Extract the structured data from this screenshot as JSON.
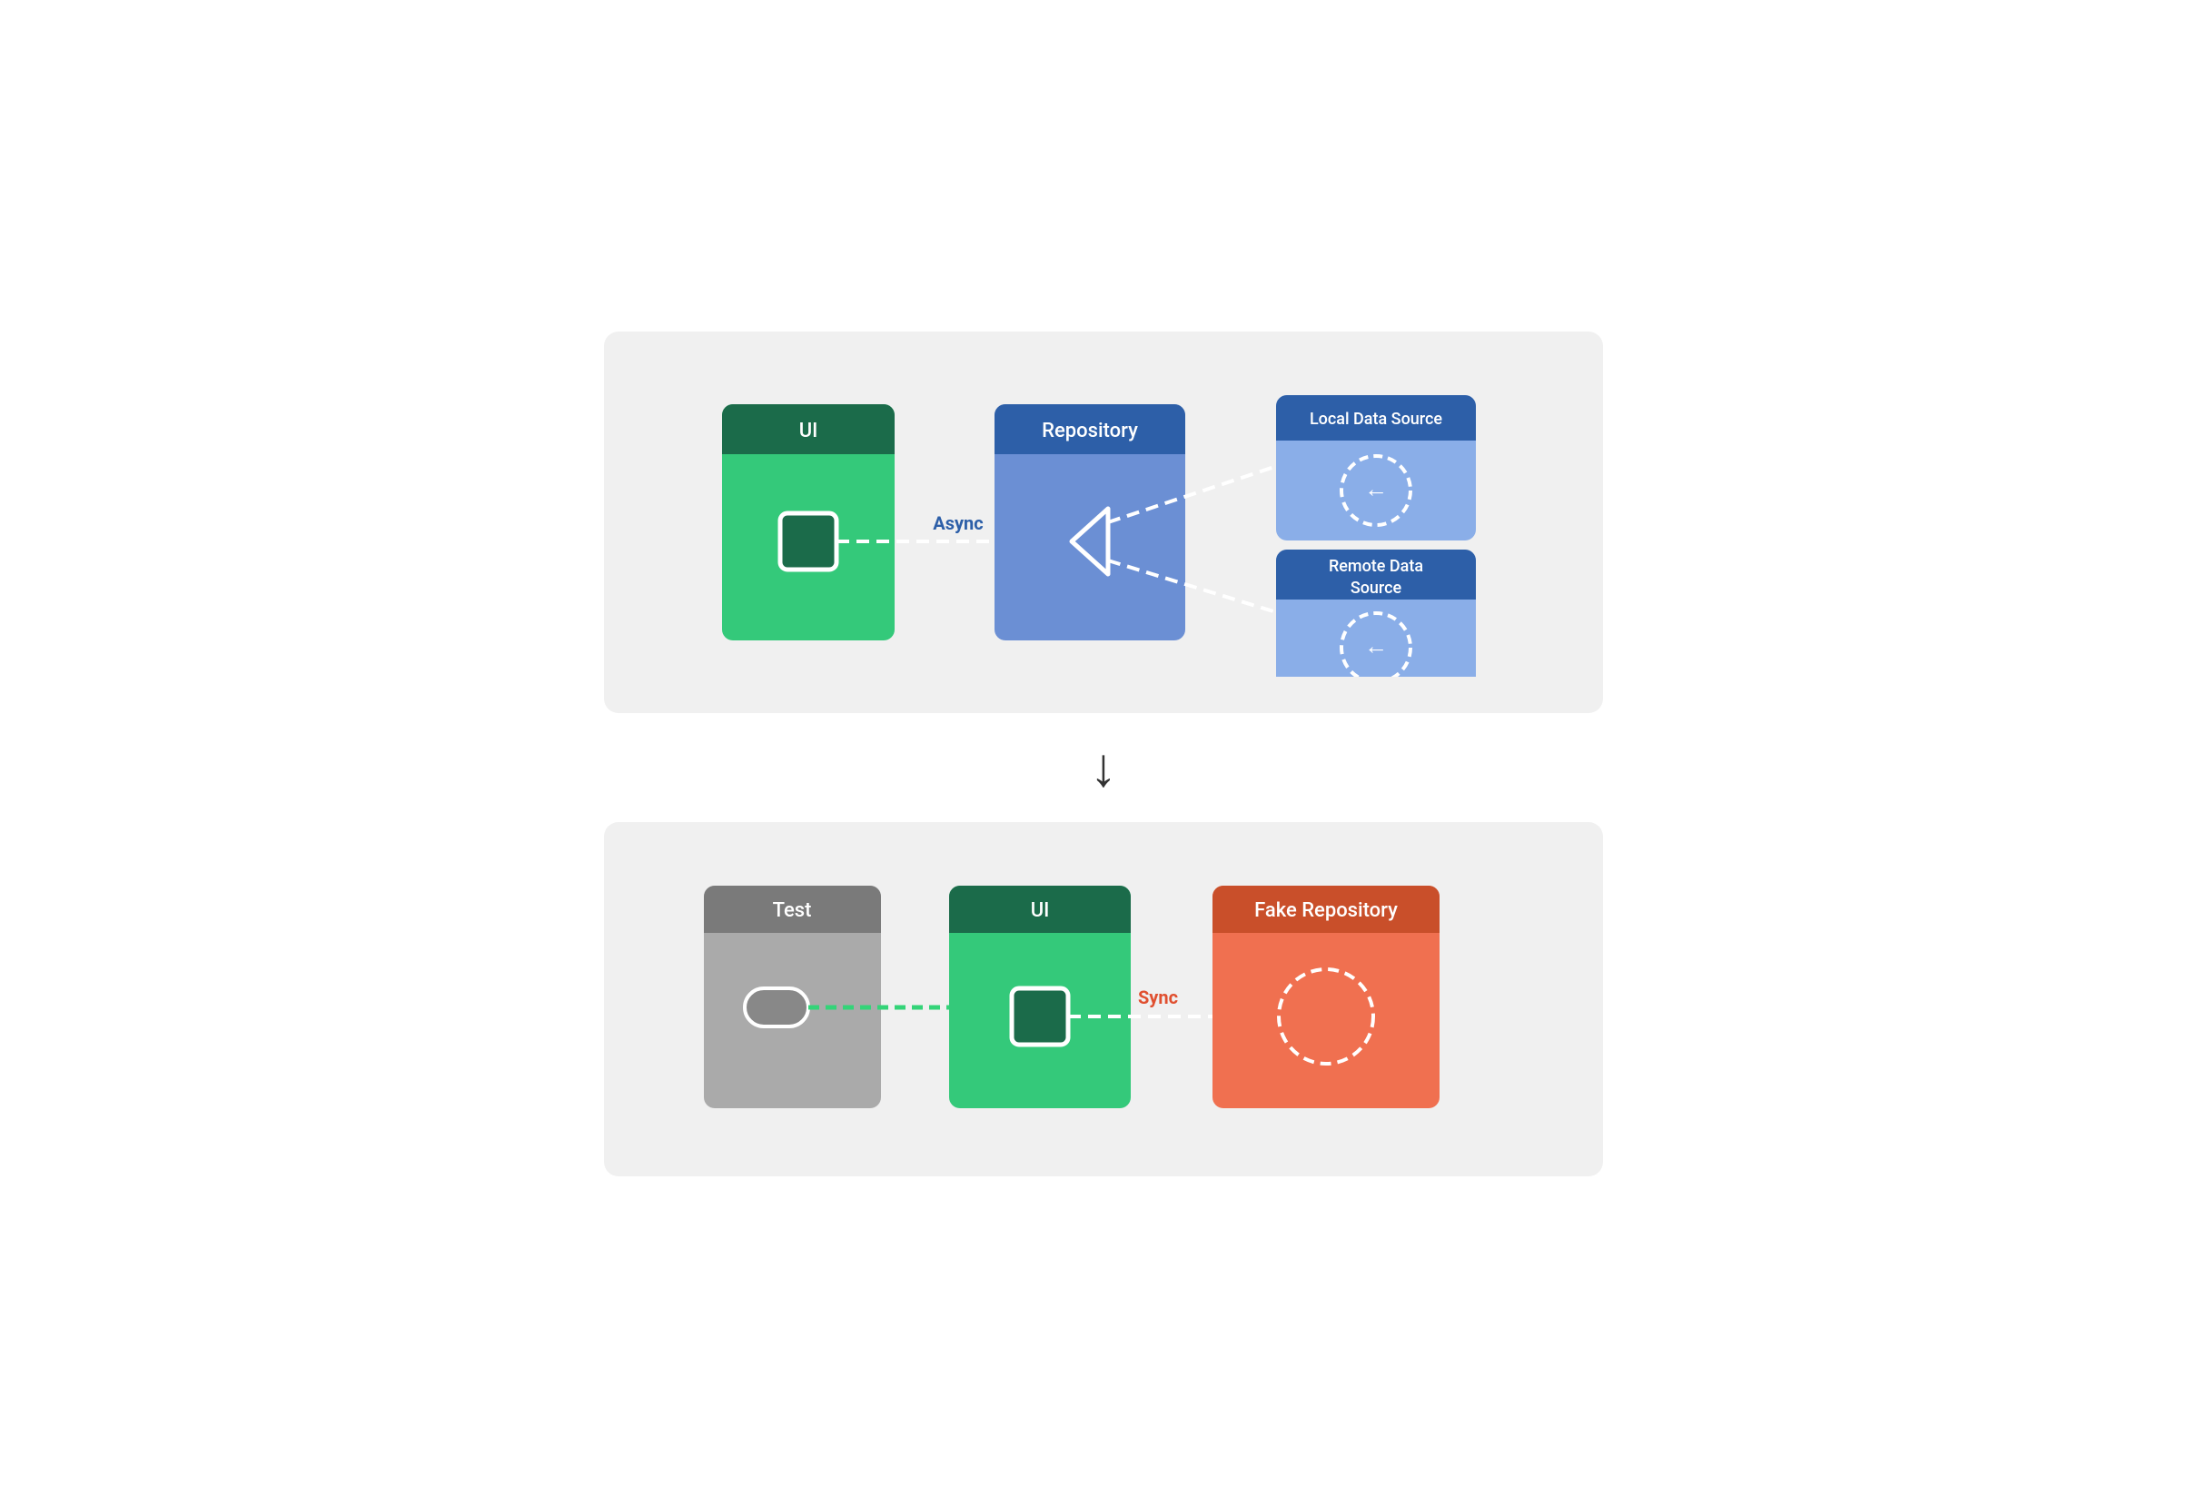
{
  "top_diagram": {
    "ui_block": {
      "header": "UI",
      "body_icon": "square"
    },
    "repo_block": {
      "header": "Repository"
    },
    "local_datasource": {
      "header": "Local Data Source"
    },
    "remote_datasource": {
      "header": "Remote Data Source"
    },
    "connector_label": "Async"
  },
  "arrow": "↓",
  "bottom_diagram": {
    "test_block": {
      "header": "Test"
    },
    "ui_block": {
      "header": "UI"
    },
    "fake_repo_block": {
      "header": "Fake Repository"
    },
    "connector_label": "Sync"
  }
}
